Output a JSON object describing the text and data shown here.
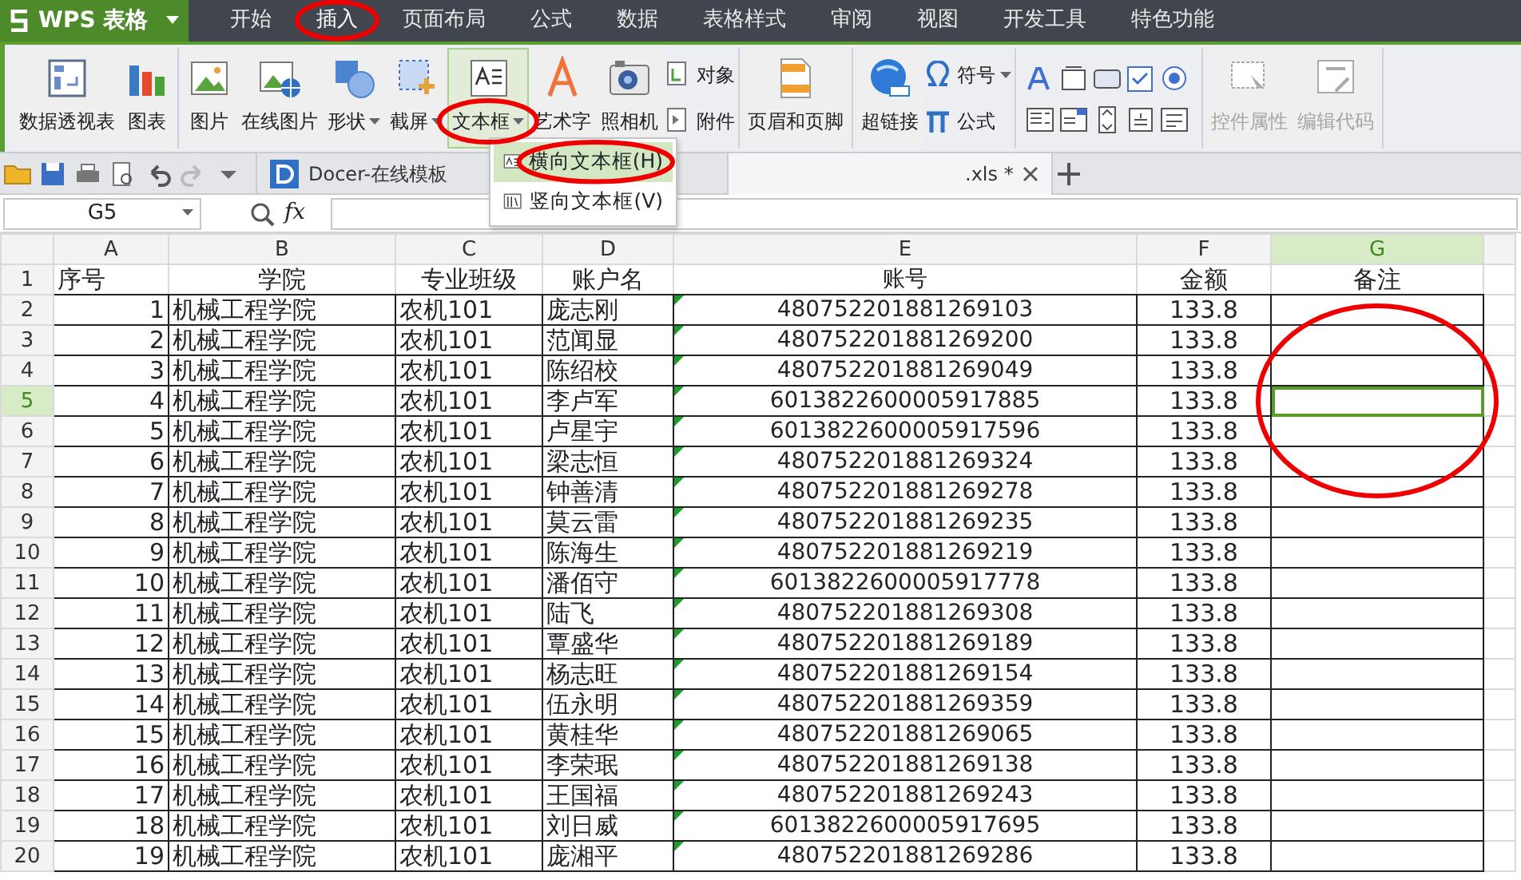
{
  "app": {
    "logo": "WPS 表格"
  },
  "menu_tabs": [
    {
      "label": "开始",
      "selected": false
    },
    {
      "label": "插入",
      "selected": true
    },
    {
      "label": "页面布局",
      "selected": false
    },
    {
      "label": "公式",
      "selected": false
    },
    {
      "label": "数据",
      "selected": false
    },
    {
      "label": "表格样式",
      "selected": false
    },
    {
      "label": "审阅",
      "selected": false
    },
    {
      "label": "视图",
      "selected": false
    },
    {
      "label": "开发工具",
      "selected": false
    },
    {
      "label": "特色功能",
      "selected": false
    }
  ],
  "ribbon": [
    {
      "items": [
        {
          "kind": "large",
          "label": "数据透视表",
          "dropdown": false,
          "selected": false,
          "disabled": false
        },
        {
          "kind": "large",
          "label": "图表",
          "dropdown": false,
          "selected": false,
          "disabled": false
        }
      ]
    },
    {
      "items": [
        {
          "kind": "large",
          "label": "图片",
          "dropdown": false,
          "selected": false,
          "disabled": false
        },
        {
          "kind": "large",
          "label": "在线图片",
          "dropdown": false,
          "selected": false,
          "disabled": false
        },
        {
          "kind": "large",
          "label": "形状",
          "dropdown": true,
          "selected": false,
          "disabled": false
        },
        {
          "kind": "large",
          "label": "截屏",
          "dropdown": true,
          "selected": false,
          "disabled": false
        },
        {
          "kind": "large",
          "label": "文本框",
          "dropdown": true,
          "selected": true,
          "disabled": false
        },
        {
          "kind": "large",
          "label": "艺术字",
          "dropdown": false,
          "selected": false,
          "disabled": false
        },
        {
          "kind": "large",
          "label": "照相机",
          "dropdown": false,
          "selected": false,
          "disabled": false
        },
        {
          "kind": "stack",
          "items": [
            {
              "label": "对象",
              "dropdown": false
            },
            {
              "label": "附件",
              "dropdown": false
            }
          ]
        }
      ]
    },
    {
      "items": [
        {
          "kind": "large",
          "label": "页眉和页脚",
          "dropdown": false,
          "selected": false,
          "disabled": false
        }
      ]
    },
    {
      "items": [
        {
          "kind": "large",
          "label": "超链接",
          "dropdown": false,
          "selected": false,
          "disabled": false
        },
        {
          "kind": "stack",
          "items": [
            {
              "label": "符号",
              "dropdown": true
            },
            {
              "label": "公式",
              "dropdown": false
            }
          ]
        }
      ]
    },
    {
      "items": [
        {
          "kind": "icon_grid"
        }
      ]
    },
    {
      "items": [
        {
          "kind": "large",
          "label": "控件属性",
          "dropdown": false,
          "selected": false,
          "disabled": true
        },
        {
          "kind": "large",
          "label": "编辑代码",
          "dropdown": false,
          "selected": false,
          "disabled": true
        }
      ]
    }
  ],
  "doc_tabs": [
    {
      "label": "Docer-在线模板",
      "selected": false,
      "closable": false
    },
    {
      "label": ".xls *",
      "selected": true,
      "closable": true
    }
  ],
  "formula_bar": {
    "name_box": "G5",
    "fx": "fx"
  },
  "dropdown_menu": {
    "items": [
      {
        "label": "横向文本框(H)",
        "selected": true
      },
      {
        "label": "竖向文本框(V)",
        "selected": false
      }
    ]
  },
  "sheet": {
    "columns": [
      {
        "label": "A",
        "selected": false
      },
      {
        "label": "B",
        "selected": false
      },
      {
        "label": "C",
        "selected": false
      },
      {
        "label": "D",
        "selected": false
      },
      {
        "label": "E",
        "selected": false
      },
      {
        "label": "F",
        "selected": false
      },
      {
        "label": "G",
        "selected": true
      }
    ],
    "rows": [
      {
        "number": "1",
        "kind": "header",
        "selected": false,
        "number_as_text": false,
        "cells": [
          "序号",
          "学院",
          "专业班级",
          "账户名",
          "账号",
          "金额",
          "备注"
        ]
      },
      {
        "number": "2",
        "kind": "data",
        "selected": false,
        "number_as_text": true,
        "cells": [
          "1",
          "机械工程学院",
          "农机101",
          "庞志刚",
          "480752201881269103",
          "133.8"
        ]
      },
      {
        "number": "3",
        "kind": "data",
        "selected": false,
        "number_as_text": true,
        "cells": [
          "2",
          "机械工程学院",
          "农机101",
          "范闻显",
          "480752201881269200",
          "133.8"
        ]
      },
      {
        "number": "4",
        "kind": "data",
        "selected": false,
        "number_as_text": true,
        "cells": [
          "3",
          "机械工程学院",
          "农机101",
          "陈绍校",
          "480752201881269049",
          "133.8"
        ]
      },
      {
        "number": "5",
        "kind": "data",
        "selected": true,
        "number_as_text": true,
        "cells": [
          "4",
          "机械工程学院",
          "农机101",
          "李卢军",
          "6013822600005917885",
          "133.8"
        ]
      },
      {
        "number": "6",
        "kind": "data",
        "selected": false,
        "number_as_text": true,
        "cells": [
          "5",
          "机械工程学院",
          "农机101",
          "卢星宇",
          "6013822600005917596",
          "133.8"
        ]
      },
      {
        "number": "7",
        "kind": "data",
        "selected": false,
        "number_as_text": true,
        "cells": [
          "6",
          "机械工程学院",
          "农机101",
          "梁志恒",
          "480752201881269324",
          "133.8"
        ]
      },
      {
        "number": "8",
        "kind": "data",
        "selected": false,
        "number_as_text": true,
        "cells": [
          "7",
          "机械工程学院",
          "农机101",
          "钟善清",
          "480752201881269278",
          "133.8"
        ]
      },
      {
        "number": "9",
        "kind": "data",
        "selected": false,
        "number_as_text": true,
        "cells": [
          "8",
          "机械工程学院",
          "农机101",
          "莫云雷",
          "480752201881269235",
          "133.8"
        ]
      },
      {
        "number": "10",
        "kind": "data",
        "selected": false,
        "number_as_text": true,
        "cells": [
          "9",
          "机械工程学院",
          "农机101",
          "陈海生",
          "480752201881269219",
          "133.8"
        ]
      },
      {
        "number": "11",
        "kind": "data",
        "selected": false,
        "number_as_text": true,
        "cells": [
          "10",
          "机械工程学院",
          "农机101",
          "潘佰守",
          "6013822600005917778",
          "133.8"
        ]
      },
      {
        "number": "12",
        "kind": "data",
        "selected": false,
        "number_as_text": true,
        "cells": [
          "11",
          "机械工程学院",
          "农机101",
          "陆飞",
          "480752201881269308",
          "133.8"
        ]
      },
      {
        "number": "13",
        "kind": "data",
        "selected": false,
        "number_as_text": true,
        "cells": [
          "12",
          "机械工程学院",
          "农机101",
          "覃盛华",
          "480752201881269189",
          "133.8"
        ]
      },
      {
        "number": "14",
        "kind": "data",
        "selected": false,
        "number_as_text": true,
        "cells": [
          "13",
          "机械工程学院",
          "农机101",
          "杨志旺",
          "480752201881269154",
          "133.8"
        ]
      },
      {
        "number": "15",
        "kind": "data",
        "selected": false,
        "number_as_text": true,
        "cells": [
          "14",
          "机械工程学院",
          "农机101",
          "伍永明",
          "480752201881269359",
          "133.8"
        ]
      },
      {
        "number": "16",
        "kind": "data",
        "selected": false,
        "number_as_text": true,
        "cells": [
          "15",
          "机械工程学院",
          "农机101",
          "黄桂华",
          "480752201881269065",
          "133.8"
        ]
      },
      {
        "number": "17",
        "kind": "data",
        "selected": false,
        "number_as_text": true,
        "cells": [
          "16",
          "机械工程学院",
          "农机101",
          "李荣珉",
          "480752201881269138",
          "133.8"
        ]
      },
      {
        "number": "18",
        "kind": "data",
        "selected": false,
        "number_as_text": true,
        "cells": [
          "17",
          "机械工程学院",
          "农机101",
          "王国福",
          "480752201881269243",
          "133.8"
        ]
      },
      {
        "number": "19",
        "kind": "data",
        "selected": false,
        "number_as_text": true,
        "cells": [
          "18",
          "机械工程学院",
          "农机101",
          "刘日威",
          "6013822600005917695",
          "133.8"
        ]
      },
      {
        "number": "20",
        "kind": "data",
        "selected": false,
        "number_as_text": true,
        "cells": [
          "19",
          "机械工程学院",
          "农机101",
          "庞湘平",
          "480752201881269286",
          "133.8"
        ]
      }
    ]
  }
}
